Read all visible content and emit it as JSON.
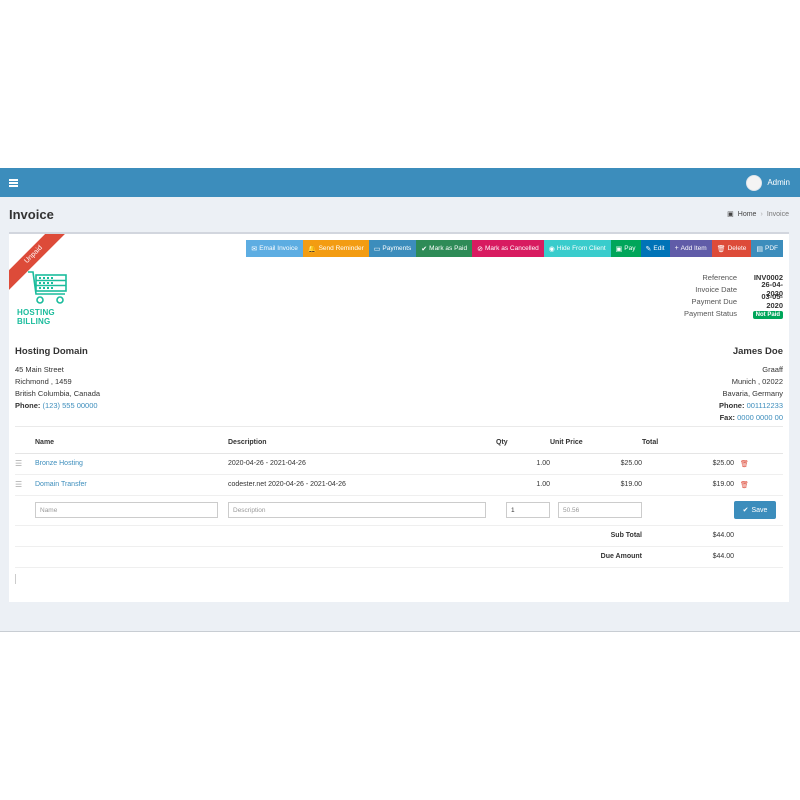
{
  "topbar": {
    "user_name": "Admin"
  },
  "header": {
    "title": "Invoice",
    "breadcrumb_home": "Home",
    "breadcrumb_current": "Invoice"
  },
  "status_ribbon": "Unpaid",
  "toolbar": [
    {
      "label": "Email Invoice",
      "icon": "envelope-icon",
      "glyph": "✉",
      "color": "#5dade2"
    },
    {
      "label": "Send Reminder",
      "icon": "bell-icon",
      "glyph": "🔔",
      "color": "#f39c12"
    },
    {
      "label": "Payments",
      "icon": "credit-card-icon",
      "glyph": "▭",
      "color": "#3c8dbc"
    },
    {
      "label": "Mark as Paid",
      "icon": "check-icon",
      "glyph": "✔",
      "color": "#2e8b57"
    },
    {
      "label": "Mark as Cancelled",
      "icon": "ban-icon",
      "glyph": "⊘",
      "color": "#d81b60"
    },
    {
      "label": "Hide From Client",
      "icon": "eye-icon",
      "glyph": "◉",
      "color": "#39cccc"
    },
    {
      "label": "Pay",
      "icon": "money-icon",
      "glyph": "▣",
      "color": "#00a65a"
    },
    {
      "label": "Edit",
      "icon": "pencil-icon",
      "glyph": "✎",
      "color": "#0073b7"
    },
    {
      "label": "Add Item",
      "icon": "plus-icon",
      "glyph": "+",
      "color": "#605ca8"
    },
    {
      "label": "Delete",
      "icon": "trash-icon",
      "glyph": "🗑",
      "color": "#dd4b39"
    },
    {
      "label": "PDF",
      "icon": "file-pdf-icon",
      "glyph": "▤",
      "color": "#3c8dbc"
    }
  ],
  "logo": {
    "text": "HOSTING BILLING",
    "color": "#1abc9c"
  },
  "meta": {
    "reference_label": "Reference",
    "reference": "INV0002",
    "invoice_date_label": "Invoice Date",
    "invoice_date": "26-04-2020",
    "payment_due_label": "Payment Due",
    "payment_due": "03-05-2020",
    "payment_status_label": "Payment Status",
    "payment_status": "Not Paid"
  },
  "from": {
    "name": "Hosting Domain",
    "address1": "45 Main Street",
    "address2": "Richmond , 1459",
    "address3": "British Columbia, Canada",
    "phone_label": "Phone:",
    "phone": "(123) 555 00000"
  },
  "to": {
    "name": "James Doe",
    "company": "Graaff",
    "address1": "Munich , 02022",
    "address2": "Bavaria, Germany",
    "phone_label": "Phone:",
    "phone": "001112233",
    "fax_label": "Fax:",
    "fax": "0000 0000 00"
  },
  "table": {
    "headers": {
      "name": "Name",
      "description": "Description",
      "qty": "Qty",
      "unit_price": "Unit Price",
      "total": "Total"
    },
    "rows": [
      {
        "name": "Bronze Hosting",
        "description": "2020-04-26 - 2021-04-26",
        "qty": "1.00",
        "unit_price": "$25.00",
        "total": "$25.00"
      },
      {
        "name": "Domain Transfer",
        "description": "codester.net 2020-04-26 - 2021-04-26",
        "qty": "1.00",
        "unit_price": "$19.00",
        "total": "$19.00"
      }
    ],
    "new_item": {
      "name_placeholder": "Name",
      "description_placeholder": "Description",
      "qty_value": "1",
      "price_placeholder": "50.56",
      "save_label": "Save"
    },
    "sub_total_label": "Sub Total",
    "sub_total": "$44.00",
    "due_amount_label": "Due Amount",
    "due_amount": "$44.00"
  }
}
